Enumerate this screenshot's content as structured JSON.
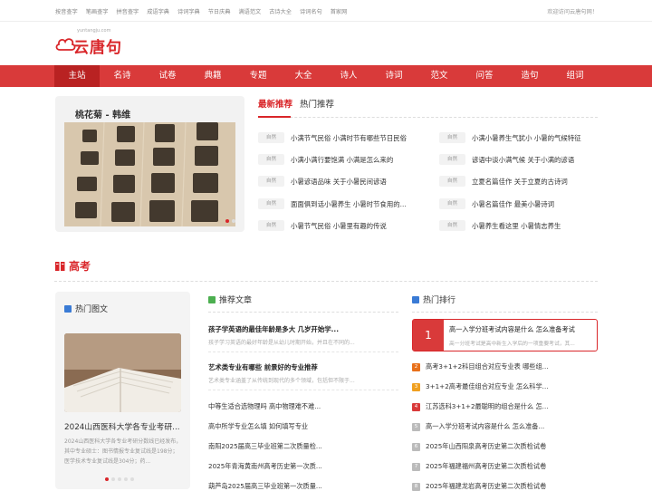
{
  "topbar": {
    "links": [
      "按音查字",
      "笔画查字",
      "拼音查字",
      "成语字典",
      "诗词字典",
      "节日庆典",
      "满语范文",
      "古诗大全",
      "诗词名句",
      "首家网"
    ],
    "welcome": "欢迎访问云唐句网！"
  },
  "logo": {
    "text": "云唐句",
    "sub": "yuntangju.com"
  },
  "nav": {
    "items": [
      "主站",
      "名诗",
      "试卷",
      "典籍",
      "专题",
      "大全",
      "诗人",
      "诗词",
      "范文",
      "问答",
      "造句",
      "组词"
    ],
    "active_index": 0
  },
  "feature": {
    "title": "桃花菊 - 韩维"
  },
  "news": {
    "tab_latest": "最新推荐",
    "tab_hot": "热门推荐",
    "items": [
      {
        "tag": "自然",
        "title": "小满节气民俗 小满时节有哪些节日民俗"
      },
      {
        "tag": "自然",
        "title": "小满小暑养生气犹小 小暑的气候特征"
      },
      {
        "tag": "自然",
        "title": "小满小满行要饱满 小满是怎么来的"
      },
      {
        "tag": "自然",
        "title": "谚语中谈小满气候 关于小满的谚语"
      },
      {
        "tag": "自然",
        "title": "小暑谚语品味 关于小暑民间谚语"
      },
      {
        "tag": "自然",
        "title": "立夏名篇佳作 关于立夏的古诗词"
      },
      {
        "tag": "自然",
        "title": "面面俱到话小暑养生 小暑时节食用的..."
      },
      {
        "tag": "自然",
        "title": "小暑名篇佳作 最美小暑诗词"
      },
      {
        "tag": "自然",
        "title": "小暑节气民俗 小暑里有趣的传说"
      },
      {
        "tag": "自然",
        "title": "小暑养生看这里 小暑情志养生"
      }
    ]
  },
  "section": {
    "title": "高考"
  },
  "hot_pictures": {
    "heading": "热门图文",
    "title": "2024山西医科大学各专业考研...",
    "desc": "2024山西医科大学各专业考研分数线已经发布，其中专业硕士：图书情报专业复试线是198分；医学技术专业复试线是304分；药..."
  },
  "recommended": {
    "heading": "推荐文章",
    "featured": [
      {
        "title": "孩子学英语的最佳年龄是多大 几岁开始学...",
        "desc": "孩子学习英语的最好年龄是从幼儿时期开始，并且在不同的..."
      },
      {
        "title": "艺术类专业有哪些 前景好的专业推荐",
        "desc": "艺术类专业涵盖了从传统到现代的多个领域，包括但不限于..."
      }
    ],
    "links": [
      "中等生适合选物理吗 高中物理难不难...",
      "高中所学专业怎么填 如何填写专业",
      "南阳2025届高三毕业班第二次质量检...",
      "2025年青海黄南州高考历史第一次质...",
      "葫芦岛2025届高三毕业班第一次质量..."
    ]
  },
  "ranking": {
    "heading": "热门排行",
    "top": {
      "num": "1",
      "title": "高一入学分班考试内容是什么 怎么准备考试",
      "desc": "高一分班考试是高中新生入学后的一项重要考试，其..."
    },
    "items": [
      {
        "num": "2",
        "title": "高考3+1+2科目组合对应专业表 哪些组..."
      },
      {
        "num": "3",
        "title": "3+1+2高考最佳组合对应专业 怎么科学..."
      },
      {
        "num": "4",
        "title": "江苏选科3+1+2最聪明的组合是什么 怎..."
      },
      {
        "num": "5",
        "title": "高一入学分班考试内容是什么 怎么准备..."
      },
      {
        "num": "6",
        "title": "2025年山西阳泉高考历史第二次质检试卷"
      },
      {
        "num": "7",
        "title": "2025年福建福州高考历史第二次质检试卷"
      },
      {
        "num": "8",
        "title": "2025年福建龙岩高考历史第二次质检试卷"
      }
    ]
  },
  "colors": {
    "brand": "#d9262a",
    "nav_bg": "#d93a3a",
    "nav_active": "#b92222",
    "rank2": "#e8701a",
    "rank3": "#f0a020",
    "rank4": "#d93a3a",
    "rank_other": "#bbbbbb"
  }
}
